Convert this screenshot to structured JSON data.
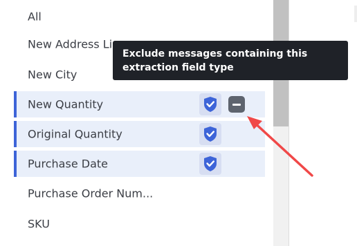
{
  "field_types": [
    {
      "label": "All",
      "selected": false,
      "checked": false
    },
    {
      "label": "New Address Line",
      "selected": false,
      "checked": false
    },
    {
      "label": "New City",
      "selected": false,
      "checked": false
    },
    {
      "label": "New Quantity",
      "selected": true,
      "checked": true,
      "exclude_button": true
    },
    {
      "label": "Original Quantity",
      "selected": true,
      "checked": true
    },
    {
      "label": "Purchase Date",
      "selected": true,
      "checked": true
    },
    {
      "label": "Purchase Order Num...",
      "selected": false,
      "checked": false
    },
    {
      "label": "SKU",
      "selected": false,
      "checked": false
    }
  ],
  "tooltip": {
    "text": "Exclude messages containing this extraction field type"
  },
  "icons": {
    "checkbox": "shield-check-icon",
    "exclude": "minus-square-icon"
  },
  "colors": {
    "accent": "#3d64d8",
    "selected_row_bg": "#e9effa",
    "tooltip_bg": "#1f2228",
    "annotation_arrow": "#f04848"
  }
}
